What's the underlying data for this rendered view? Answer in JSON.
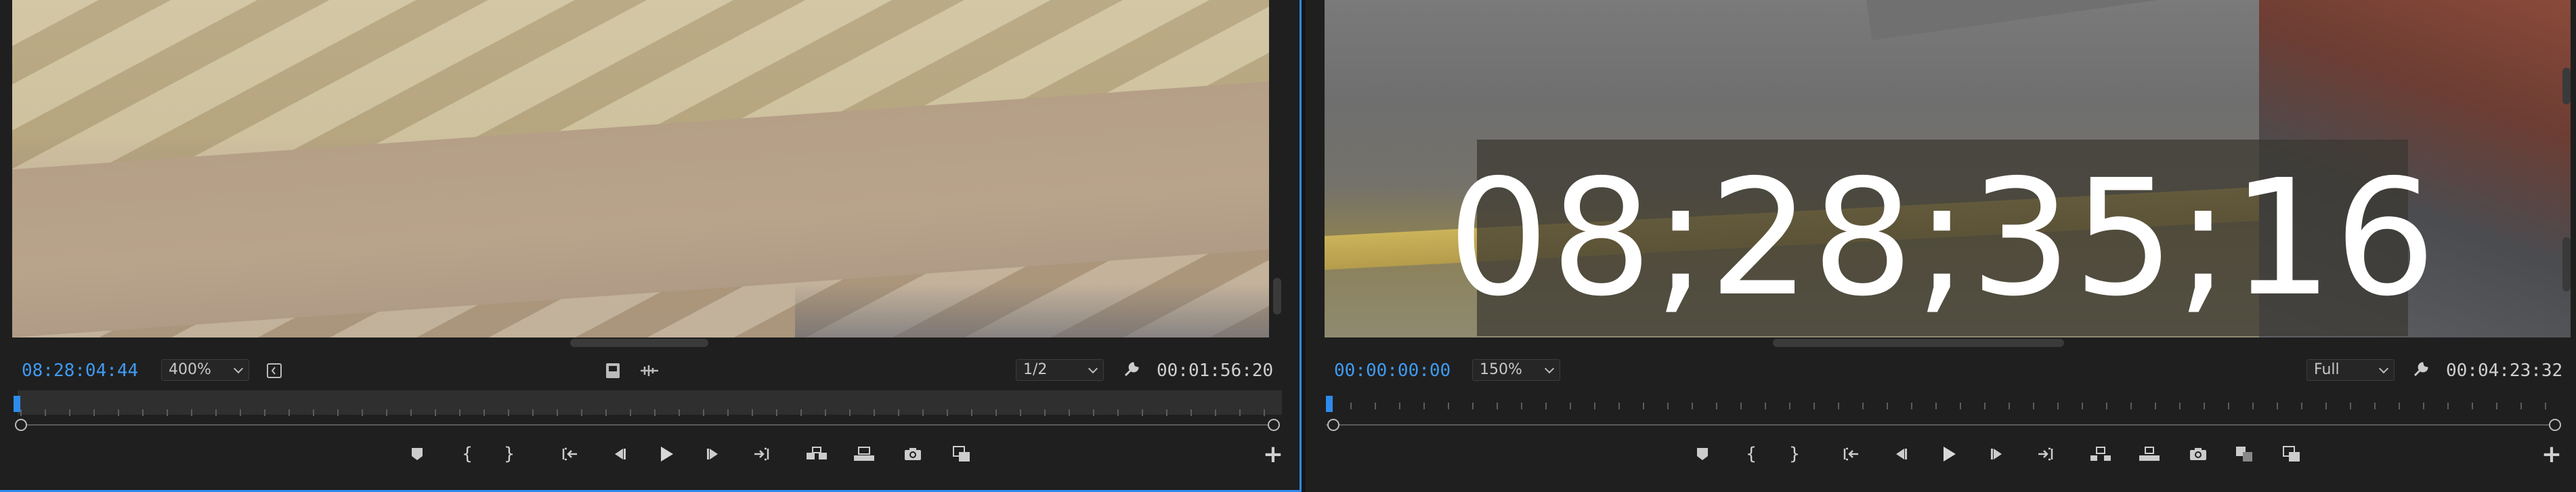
{
  "source": {
    "timecode": "08:28:04:44",
    "zoom": "400%",
    "resolution": "1/2",
    "duration": "00:01:56:20"
  },
  "program": {
    "timecode": "00:00:00:00",
    "zoom": "150%",
    "resolution": "Full",
    "duration": "00:04:23:32",
    "overlay_timecode": "08;28;35;16"
  },
  "transport_icons": [
    "add-marker-icon",
    "mark-in-icon",
    "mark-out-icon",
    "go-to-in-icon",
    "step-back-icon",
    "play-icon",
    "step-forward-icon",
    "go-to-out-icon",
    "insert-icon",
    "overwrite-icon",
    "export-frame-icon"
  ],
  "accent_color": "#2d8ceb",
  "timecode_color": "#3f9bf4"
}
